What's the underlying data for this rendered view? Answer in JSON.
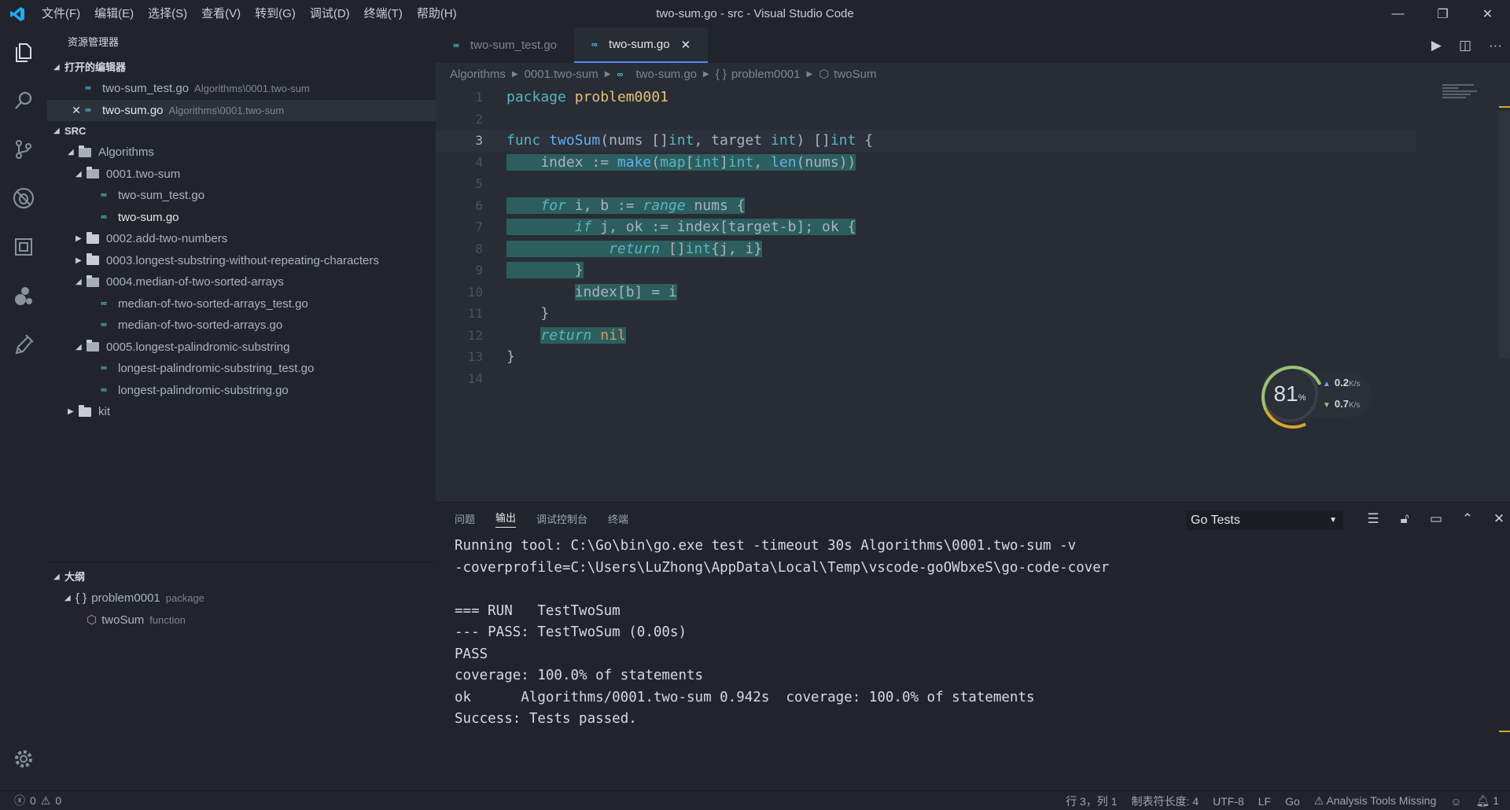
{
  "titlebar": {
    "menu": [
      "文件(F)",
      "编辑(E)",
      "选择(S)",
      "查看(V)",
      "转到(G)",
      "调试(D)",
      "终端(T)",
      "帮助(H)"
    ],
    "title": "two-sum.go - src - Visual Studio Code"
  },
  "activitybar": {
    "icons": [
      "explorer-icon",
      "search-icon",
      "source-control-icon",
      "debug-icon",
      "extensions-icon",
      "remote-icon",
      "test-icon"
    ],
    "bottom": "gear-icon"
  },
  "sidebar": {
    "title": "资源管理器",
    "open_editors": {
      "header": "打开的编辑器",
      "items": [
        {
          "name": "two-sum_test.go",
          "path": "Algorithms\\0001.two-sum"
        },
        {
          "name": "two-sum.go",
          "path": "Algorithms\\0001.two-sum"
        }
      ]
    },
    "src": {
      "header": "SRC",
      "tree": [
        {
          "label": "Algorithms"
        },
        {
          "label": "0001.two-sum"
        },
        {
          "label": "two-sum_test.go"
        },
        {
          "label": "two-sum.go"
        },
        {
          "label": "0002.add-two-numbers"
        },
        {
          "label": "0003.longest-substring-without-repeating-characters"
        },
        {
          "label": "0004.median-of-two-sorted-arrays"
        },
        {
          "label": "median-of-two-sorted-arrays_test.go"
        },
        {
          "label": "median-of-two-sorted-arrays.go"
        },
        {
          "label": "0005.longest-palindromic-substring"
        },
        {
          "label": "longest-palindromic-substring_test.go"
        },
        {
          "label": "longest-palindromic-substring.go"
        },
        {
          "label": "kit"
        }
      ]
    },
    "outline": {
      "header": "大纲",
      "items": [
        {
          "name": "problem0001",
          "kind": "package"
        },
        {
          "name": "twoSum",
          "kind": "function"
        }
      ]
    }
  },
  "editor": {
    "tabs": [
      {
        "label": "two-sum_test.go",
        "active": false
      },
      {
        "label": "two-sum.go",
        "active": true
      }
    ],
    "breadcrumb": [
      "Algorithms",
      "0001.two-sum",
      "two-sum.go",
      "problem0001",
      "twoSum"
    ],
    "line_numbers": [
      "1",
      "2",
      "3",
      "4",
      "5",
      "6",
      "7",
      "8",
      "9",
      "10",
      "11",
      "12",
      "13",
      "14"
    ],
    "current_line": 3
  },
  "speed_widget": {
    "percent": "81",
    "percent_unit": "%",
    "upload": "0.2",
    "download": "0.7",
    "unit": "K/s"
  },
  "panel": {
    "tabs": [
      "问题",
      "输出",
      "调试控制台",
      "终端"
    ],
    "active_tab": "输出",
    "channel": "Go Tests",
    "output": [
      "Running tool: C:\\Go\\bin\\go.exe test -timeout 30s Algorithms\\0001.two-sum -v",
      "-coverprofile=C:\\Users\\LuZhong\\AppData\\Local\\Temp\\vscode-goOWbxeS\\go-code-cover",
      "",
      "=== RUN   TestTwoSum",
      "--- PASS: TestTwoSum (0.00s)",
      "PASS",
      "coverage: 100.0% of statements",
      "ok      Algorithms/0001.two-sum 0.942s  coverage: 100.0% of statements",
      "Success: Tests passed."
    ]
  },
  "statusbar": {
    "errors": "0",
    "warnings": "0",
    "position": "行 3，列 1",
    "tab_size": "制表符长度: 4",
    "encoding": "UTF-8",
    "eol": "LF",
    "language": "Go",
    "analysis": "Analysis Tools Missing",
    "notifications": "1"
  },
  "colors": {
    "accent": "#528bff",
    "go_icon": "#4fc1e9",
    "highlight": "#2d5e5e",
    "keyword": "#56b6c2",
    "function": "#61afef"
  }
}
